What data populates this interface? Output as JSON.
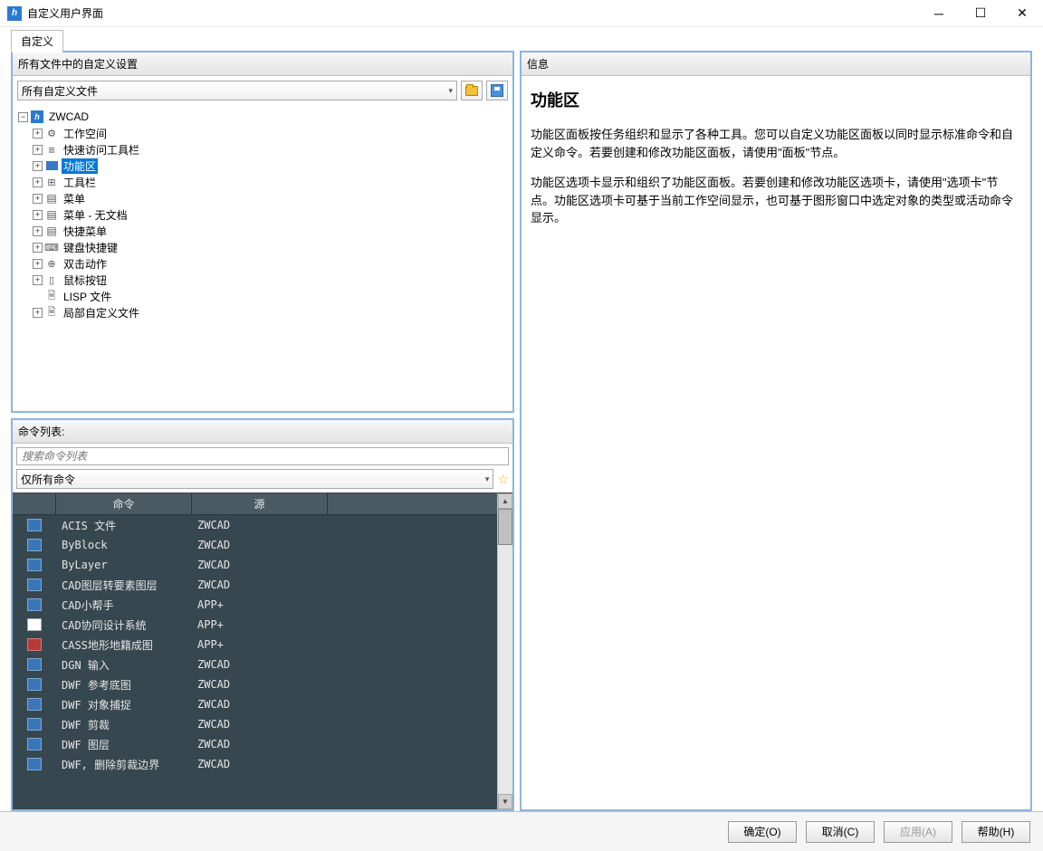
{
  "window": {
    "title": "自定义用户界面"
  },
  "tabs": [
    {
      "label": "自定义"
    }
  ],
  "settings_panel": {
    "header": "所有文件中的自定义设置",
    "file_select": "所有自定义文件"
  },
  "tree": {
    "root": "ZWCAD",
    "items": [
      {
        "label": "工作空间",
        "icon": "gear"
      },
      {
        "label": "快速访问工具栏",
        "icon": "bars"
      },
      {
        "label": "功能区",
        "icon": "ribbon",
        "selected": true
      },
      {
        "label": "工具栏",
        "icon": "toolbar"
      },
      {
        "label": "菜单",
        "icon": "menu",
        "noexp": true
      },
      {
        "label": "菜单 - 无文档",
        "icon": "menu",
        "noexp": true
      },
      {
        "label": "快捷菜单",
        "icon": "menu"
      },
      {
        "label": "键盘快捷键",
        "icon": "kbd"
      },
      {
        "label": "双击动作",
        "icon": "click"
      },
      {
        "label": "鼠标按钮",
        "icon": "mouse"
      },
      {
        "label": "LISP  文件",
        "icon": "file",
        "leaf": true
      },
      {
        "label": "局部自定义文件",
        "icon": "file"
      }
    ]
  },
  "command_panel": {
    "header": "命令列表:",
    "search_placeholder": "搜索命令列表",
    "filter": "仅所有命令",
    "columns": {
      "c1": "命令",
      "c2": "源"
    },
    "rows": [
      {
        "cmd": "ACIS 文件",
        "src": "ZWCAD"
      },
      {
        "cmd": "ByBlock",
        "src": "ZWCAD"
      },
      {
        "cmd": "ByLayer",
        "src": "ZWCAD"
      },
      {
        "cmd": "CAD图层转要素图层",
        "src": "ZWCAD"
      },
      {
        "cmd": "CAD小帮手",
        "src": "APP+"
      },
      {
        "cmd": "CAD协同设计系统",
        "src": "APP+",
        "iconcls": "alt2"
      },
      {
        "cmd": "CASS地形地籍成图",
        "src": "APP+",
        "iconcls": "alt1"
      },
      {
        "cmd": "DGN 输入",
        "src": "ZWCAD"
      },
      {
        "cmd": "DWF 参考底图",
        "src": "ZWCAD"
      },
      {
        "cmd": "DWF 对象捕捉",
        "src": "ZWCAD"
      },
      {
        "cmd": "DWF 剪裁",
        "src": "ZWCAD"
      },
      {
        "cmd": "DWF 图层",
        "src": "ZWCAD"
      },
      {
        "cmd": "DWF, 删除剪裁边界",
        "src": "ZWCAD"
      }
    ]
  },
  "info_panel": {
    "header": "信息",
    "title": "功能区",
    "p1": "功能区面板按任务组织和显示了各种工具。您可以自定义功能区面板以同时显示标准命令和自定义命令。若要创建和修改功能区面板，请使用\"面板\"节点。",
    "p2": "功能区选项卡显示和组织了功能区面板。若要创建和修改功能区选项卡，请使用\"选项卡\"节点。功能区选项卡可基于当前工作空间显示，也可基于图形窗口中选定对象的类型或活动命令显示。"
  },
  "footer": {
    "ok": "确定(O)",
    "cancel": "取消(C)",
    "apply": "应用(A)",
    "help": "帮助(H)"
  }
}
